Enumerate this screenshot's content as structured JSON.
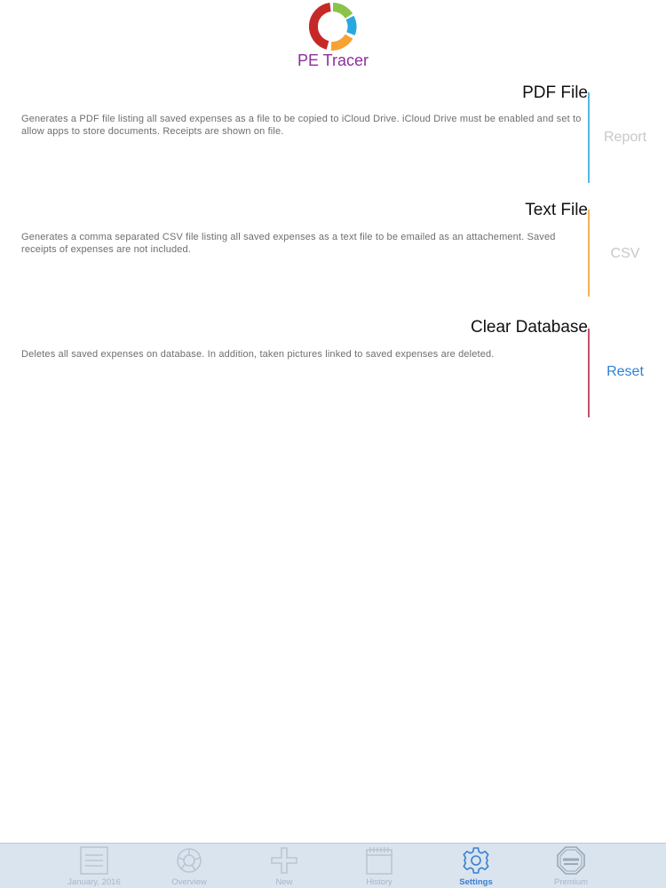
{
  "app": {
    "title": "PE Tracer",
    "logo_icon": "donut-logo-icon",
    "logo_colors": [
      "#c62828",
      "#8bc34a",
      "#29a8e0",
      "#f7a233"
    ]
  },
  "sections": [
    {
      "title": "PDF File",
      "description": "Generates a PDF file listing all saved expenses as a file to be copied to iCloud Drive. iCloud Drive must be enabled and set to allow apps to store documents. Receipts are shown on file.",
      "action_label": "Report",
      "action_enabled": false,
      "bar_color": "#5ab4e6"
    },
    {
      "title": "Text File",
      "description": "Generates a comma separated CSV file listing all saved expenses as a text file to be emailed as an attachement. Saved receipts of expenses are not included.",
      "action_label": "CSV",
      "action_enabled": false,
      "bar_color": "#f2b35a"
    },
    {
      "title": "Clear Database",
      "description": "Deletes all saved expenses on database. In addition, taken pictures linked to saved expenses are deleted.",
      "action_label": "Reset",
      "action_enabled": true,
      "bar_color": "#c0546a"
    }
  ],
  "tab_bar": {
    "active_color": "#3b7fd0",
    "inactive_color": "#a8b6c4",
    "tabs": [
      {
        "label": "January, 2016",
        "icon": "calendar-list-icon",
        "active": false
      },
      {
        "label": "Overview",
        "icon": "overview-donut-icon",
        "active": false
      },
      {
        "label": "New",
        "icon": "plus-icon",
        "active": false
      },
      {
        "label": "History",
        "icon": "notepad-icon",
        "active": false
      },
      {
        "label": "Settings",
        "icon": "gear-icon",
        "active": true
      },
      {
        "label": "Premium",
        "icon": "stop-ads-icon",
        "active": false
      }
    ]
  }
}
